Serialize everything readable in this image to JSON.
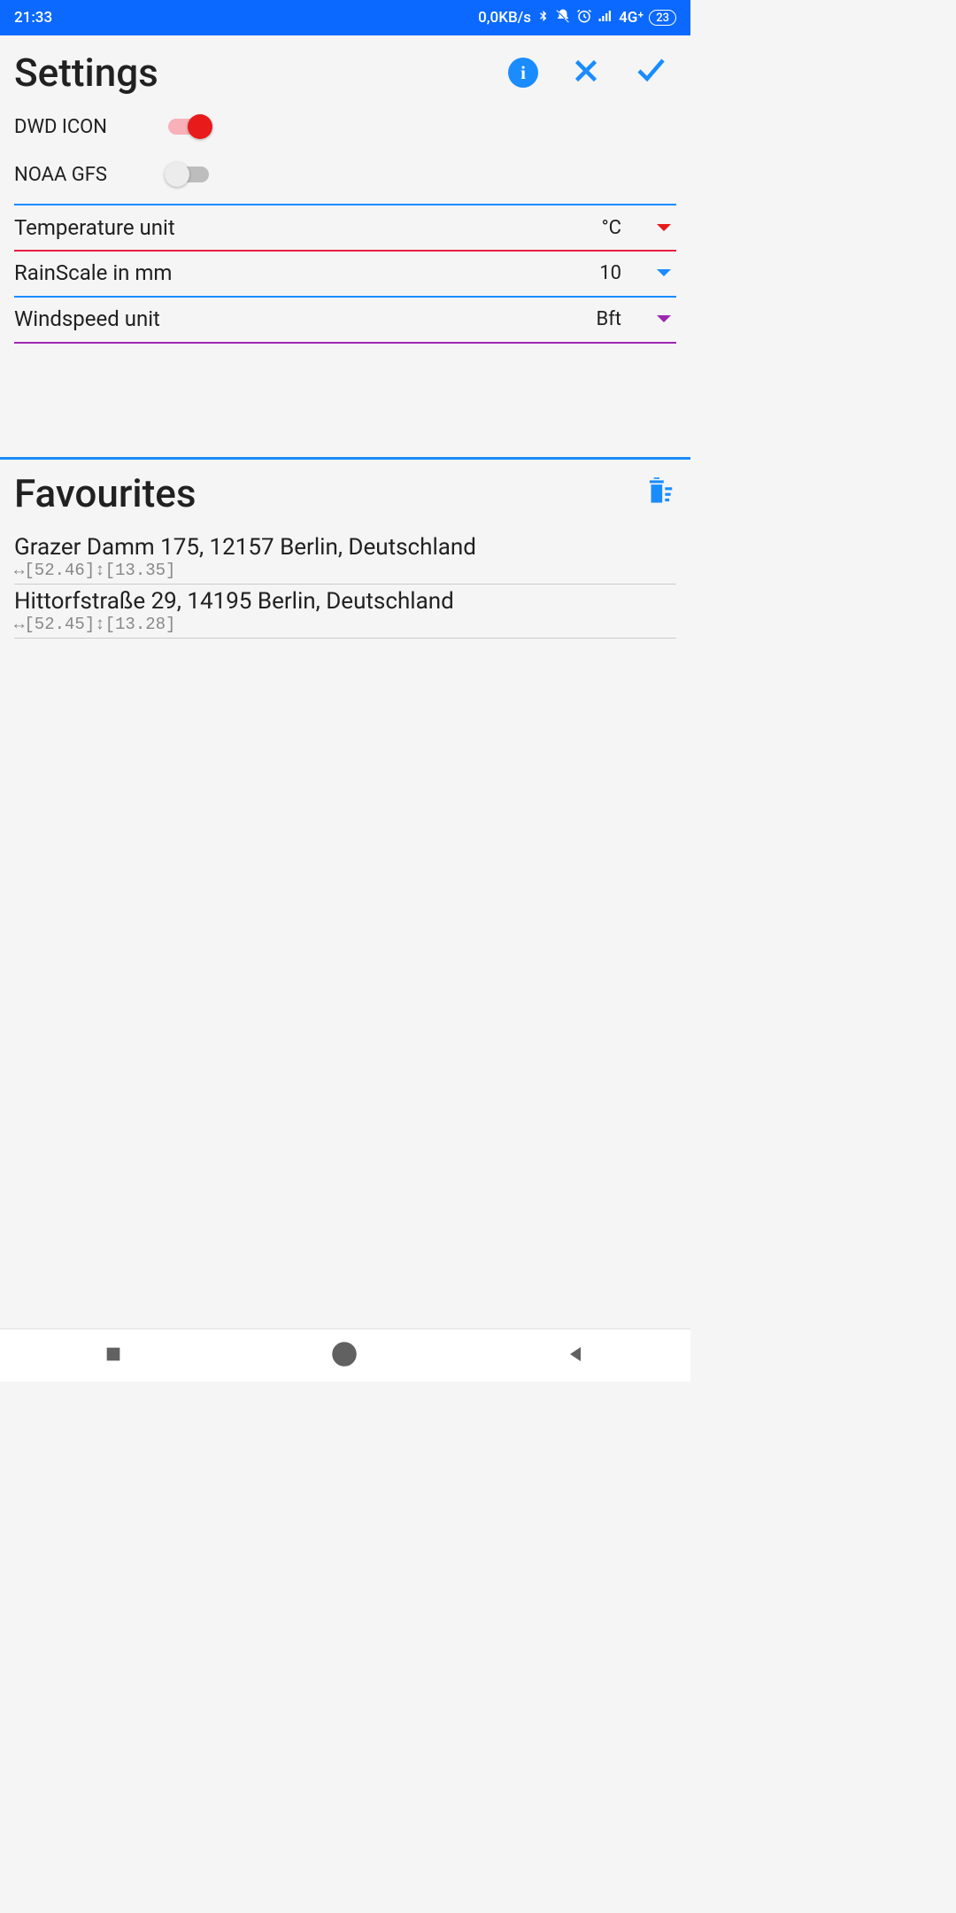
{
  "statusBar": {
    "time": "21:33",
    "speed": "0,0KB/s",
    "network": "4G⁺",
    "battery": "23"
  },
  "header": {
    "title": "Settings"
  },
  "toggles": [
    {
      "label": "DWD ICON",
      "on": true
    },
    {
      "label": "NOAA GFS",
      "on": false
    }
  ],
  "dropdowns": [
    {
      "label": "Temperature unit",
      "value": "°C",
      "color": "red"
    },
    {
      "label": "RainScale in mm",
      "value": "10",
      "color": "blue"
    },
    {
      "label": "Windspeed unit",
      "value": "Bft",
      "color": "purple"
    }
  ],
  "favourites": {
    "title": "Favourites",
    "items": [
      {
        "address": "Grazer Damm 175, 12157 Berlin, Deutschland",
        "coords": "↔[52.46]↕[13.35]"
      },
      {
        "address": "Hittorfstraße 29, 14195 Berlin, Deutschland",
        "coords": "↔[52.45]↕[13.28]"
      }
    ]
  }
}
